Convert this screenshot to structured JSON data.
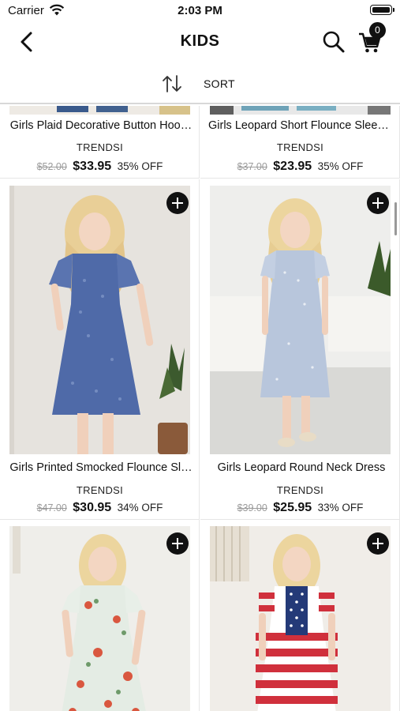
{
  "status_bar": {
    "carrier": "Carrier",
    "time": "2:03 PM"
  },
  "nav": {
    "title": "KIDS",
    "cart_count": "0"
  },
  "sort": {
    "label": "SORT"
  },
  "products": [
    {
      "name": "Girls Plaid Decorative Button Hoo…",
      "brand": "TRENDSI",
      "original_price": "$52.00",
      "sale_price": "$33.95",
      "discount": "35% OFF"
    },
    {
      "name": "Girls Leopard Short Flounce Sleev…",
      "brand": "TRENDSI",
      "original_price": "$37.00",
      "sale_price": "$23.95",
      "discount": "35% OFF"
    },
    {
      "name": "Girls Printed Smocked Flounce Sl…",
      "brand": "TRENDSI",
      "original_price": "$47.00",
      "sale_price": "$30.95",
      "discount": "34% OFF"
    },
    {
      "name": "Girls Leopard Round Neck Dress",
      "brand": "TRENDSI",
      "original_price": "$39.00",
      "sale_price": "$25.95",
      "discount": "33% OFF"
    },
    {
      "name": "",
      "brand": "",
      "original_price": "",
      "sale_price": "",
      "discount": ""
    },
    {
      "name": "",
      "brand": "",
      "original_price": "",
      "sale_price": "",
      "discount": ""
    }
  ],
  "icons": {
    "wifi": "wifi-icon",
    "battery": "battery-icon",
    "back": "chevron-left-icon",
    "search": "search-icon",
    "cart": "cart-icon",
    "sort": "sort-arrows-icon",
    "add": "plus-icon"
  }
}
